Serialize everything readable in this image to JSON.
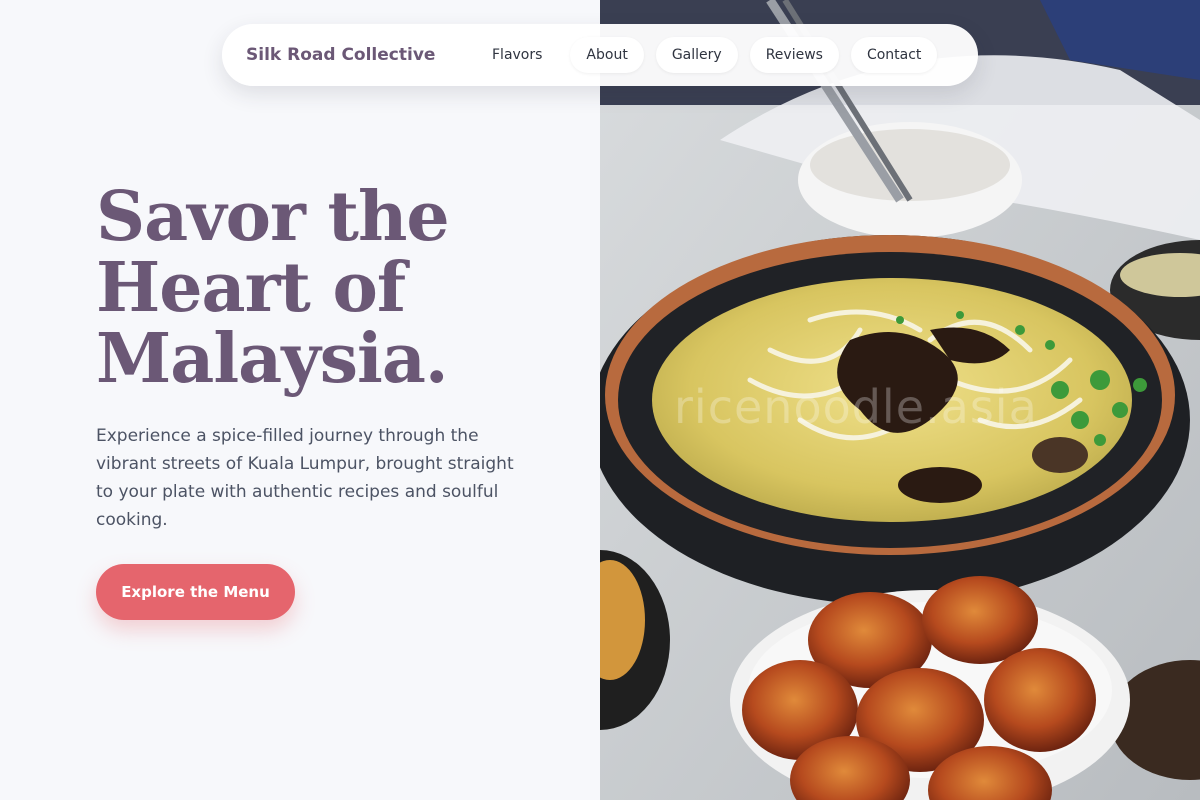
{
  "nav": {
    "brand": "Silk Road Collective",
    "links": [
      {
        "label": "Flavors"
      },
      {
        "label": "About"
      },
      {
        "label": "Gallery"
      },
      {
        "label": "Reviews"
      },
      {
        "label": "Contact"
      }
    ]
  },
  "hero": {
    "headline_lines": [
      "Savor the",
      "Heart of",
      "Malaysia."
    ],
    "subtext": "Experience a spice-filled journey through the vibrant streets of Kuala Lumpur, brought straight to your plate with authentic recipes and soulful cooking.",
    "cta_label": "Explore the Menu",
    "photo_watermark": "ricenoodle.asia"
  },
  "colors": {
    "brand_purple": "#6b5876",
    "cta_coral": "#e5656d",
    "page_bg": "#f7f8fb",
    "body_text": "#4c5364"
  }
}
